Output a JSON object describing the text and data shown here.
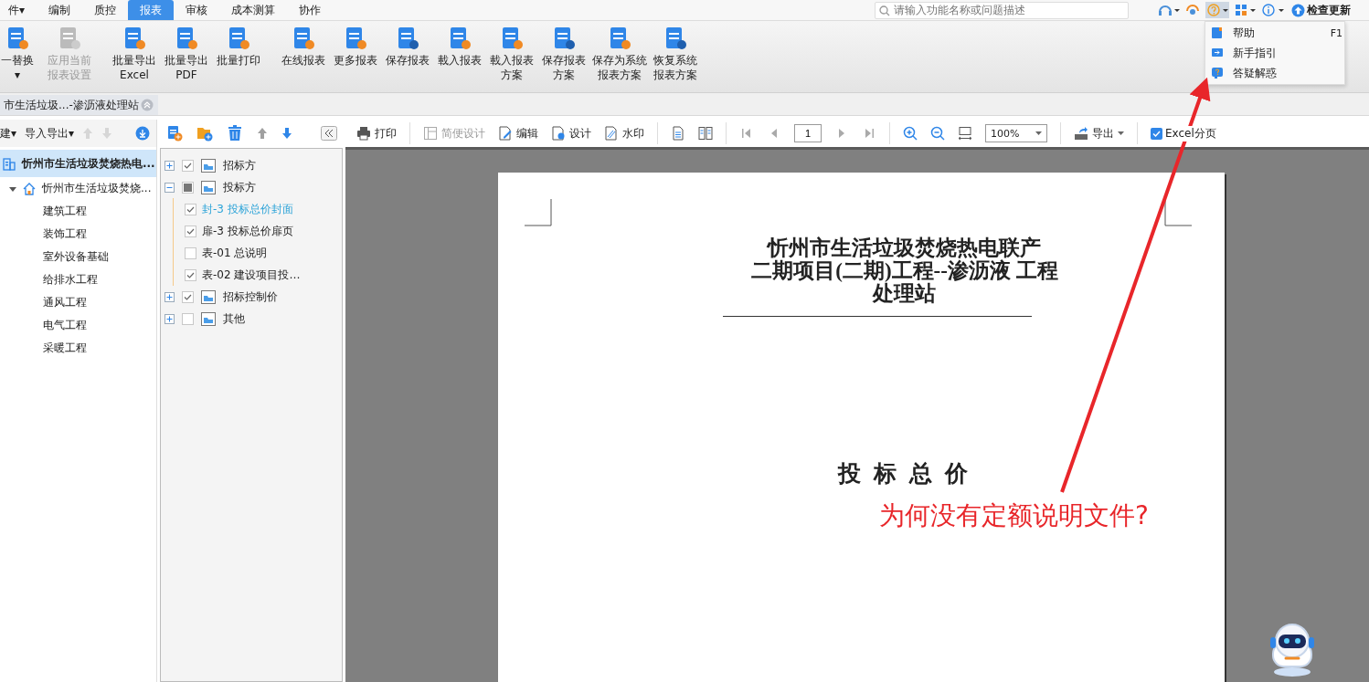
{
  "menu_tabs": [
    {
      "label": "件▾",
      "selected": false
    },
    {
      "label": "编制",
      "selected": false
    },
    {
      "label": "质控",
      "selected": false
    },
    {
      "label": "报表",
      "selected": true
    },
    {
      "label": "审核",
      "selected": false
    },
    {
      "label": "成本测算",
      "selected": false
    },
    {
      "label": "协作",
      "selected": false
    }
  ],
  "search": {
    "placeholder": "请输入功能名称或问题描述"
  },
  "update_label": "检查更新",
  "ribbon_buttons": [
    {
      "lines": [
        "一替换",
        "▾"
      ],
      "disabled": false,
      "kind": "replace"
    },
    {
      "lines": [
        "应用当前",
        "报表设置"
      ],
      "disabled": true,
      "kind": "apply"
    },
    {
      "lines": [
        "批量导出",
        "Excel"
      ],
      "disabled": false,
      "kind": "excel"
    },
    {
      "lines": [
        "批量导出",
        "PDF"
      ],
      "disabled": false,
      "kind": "pdf"
    },
    {
      "lines": [
        "批量打印"
      ],
      "disabled": false,
      "kind": "print"
    },
    {
      "lines": [
        "在线报表"
      ],
      "disabled": false,
      "kind": "cloud"
    },
    {
      "lines": [
        "更多报表"
      ],
      "disabled": false,
      "kind": "more"
    },
    {
      "lines": [
        "保存报表"
      ],
      "disabled": false,
      "kind": "save"
    },
    {
      "lines": [
        "載入报表"
      ],
      "disabled": false,
      "kind": "load"
    },
    {
      "lines": [
        "載入报表",
        "方案"
      ],
      "disabled": false,
      "kind": "load"
    },
    {
      "lines": [
        "保存报表",
        "方案"
      ],
      "disabled": false,
      "kind": "save"
    },
    {
      "lines": [
        "保存为系统",
        "报表方案"
      ],
      "disabled": false,
      "kind": "restore"
    },
    {
      "lines": [
        "恢复系统",
        "报表方案"
      ],
      "disabled": false,
      "kind": "save"
    }
  ],
  "help_menu": [
    {
      "label": "帮助",
      "shortcut": "F1",
      "kind": "book"
    },
    {
      "label": "新手指引",
      "kind": "guide"
    },
    {
      "label": "答疑解惑",
      "kind": "question"
    }
  ],
  "doc_tab": "市生活垃圾...-渗沥液处理站",
  "left_toolbar": [
    "建▾",
    "导入导出▾"
  ],
  "project_tree": [
    {
      "label": "忻州市生活垃圾焚烧热电...",
      "selected": true,
      "kind": "building",
      "children": [
        {
          "label": "忻州市生活垃圾焚烧...",
          "selected": false,
          "expanded": true,
          "kind": "house",
          "children": [
            {
              "label": "建筑工程",
              "selected": false
            },
            {
              "label": "装饰工程",
              "selected": false
            },
            {
              "label": "室外设备基础",
              "selected": false
            },
            {
              "label": "给排水工程",
              "selected": false
            },
            {
              "label": "通风工程",
              "selected": false
            },
            {
              "label": "电气工程",
              "selected": false
            },
            {
              "label": "采暖工程",
              "selected": false
            }
          ]
        }
      ]
    }
  ],
  "report_tree": [
    {
      "label": "招标方",
      "expanded": false,
      "checked": true,
      "indeterminate": false,
      "selected": false
    },
    {
      "label": "投标方",
      "expanded": true,
      "checked": false,
      "indeterminate": true,
      "selected": false,
      "children": [
        {
          "label": "封-3  投标总价封面",
          "checked": true,
          "indeterminate": false,
          "selected": true
        },
        {
          "label": "扉-3  投标总价扉页",
          "checked": true,
          "indeterminate": false,
          "selected": false
        },
        {
          "label": "表-01  总说明",
          "checked": false,
          "indeterminate": false,
          "selected": false
        },
        {
          "label": "表-02  建设项目投…",
          "checked": true,
          "indeterminate": false,
          "selected": false
        }
      ]
    },
    {
      "label": "招标控制价",
      "expanded": false,
      "checked": true,
      "indeterminate": false,
      "selected": false
    },
    {
      "label": "其他",
      "expanded": false,
      "checked": false,
      "indeterminate": false,
      "selected": false
    }
  ],
  "preview_toolbar": {
    "print": "打印",
    "simple_design": {
      "label": "简便设计",
      "disabled": true
    },
    "edit": "编辑",
    "design": "设计",
    "watermark": "水印",
    "page": "1",
    "zoom": "100%",
    "export": "导出",
    "excel_paging": {
      "label": "Excel分页",
      "checked": true
    }
  },
  "document": {
    "title_lines": [
      "忻州市生活垃圾焚烧热电联产",
      "二期项目(二期)工程--渗沥液 工程",
      "处理站"
    ],
    "heading": "投 标 总 价"
  },
  "annotation": "为何没有定额说明文件?"
}
